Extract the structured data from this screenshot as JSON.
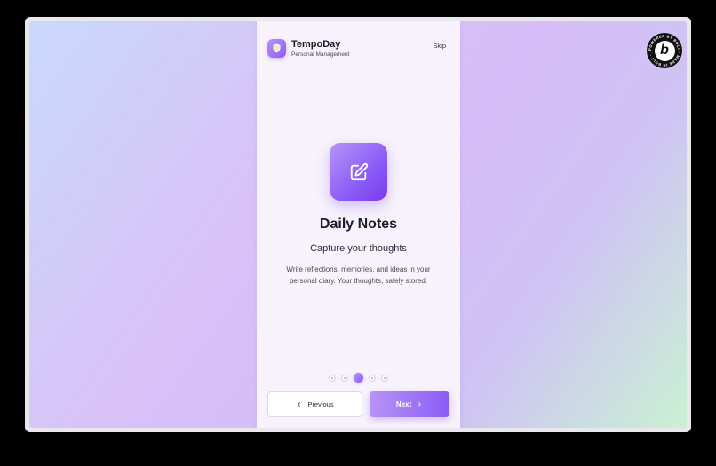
{
  "app": {
    "name": "TempoDay",
    "subtitle": "Personal Management",
    "logo_icon": "shield-icon"
  },
  "header": {
    "skip_label": "Skip"
  },
  "slide": {
    "icon": "edit-icon",
    "title": "Daily Notes",
    "subtitle": "Capture your thoughts",
    "description": "Write reflections, memories, and ideas in your personal diary. Your thoughts, safely stored."
  },
  "pagination": {
    "total": 5,
    "current": 3
  },
  "nav": {
    "previous_label": "Previous",
    "next_label": "Next"
  },
  "badge": {
    "letter": "b",
    "ring_text": "POWERED BY BOLT · MADE IN BOLT · "
  },
  "colors": {
    "accent": "#8b5cf6",
    "accent_light": "#b794f6",
    "card_bg": "#f7f2fb",
    "text_dark": "#1c1b2e"
  }
}
